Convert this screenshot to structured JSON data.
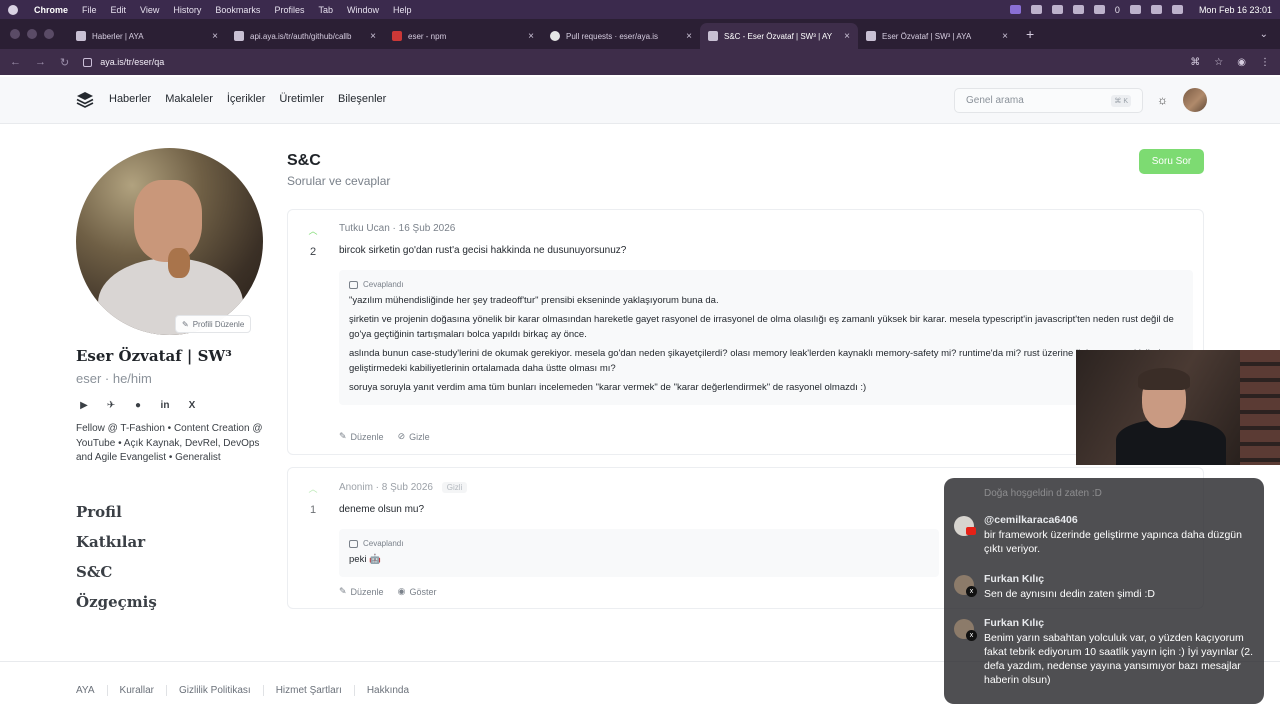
{
  "menubar": {
    "app": "Chrome",
    "items": [
      "File",
      "Edit",
      "View",
      "History",
      "Bookmarks",
      "Profiles",
      "Tab",
      "Window",
      "Help"
    ],
    "status_count": "0",
    "clock": "Mon Feb 16  23:01"
  },
  "tabs": [
    {
      "title": "Haberler | AYA",
      "active": false
    },
    {
      "title": "api.aya.is/tr/auth/github/callb",
      "active": false
    },
    {
      "title": "eser - npm",
      "active": false
    },
    {
      "title": "Pull requests · eser/aya.is",
      "active": false
    },
    {
      "title": "S&C - Eser Özvataf | SW³ | AY",
      "active": true
    },
    {
      "title": "Eser Özvataf | SW³ | AYA",
      "active": false
    }
  ],
  "address": {
    "url": "aya.is/tr/eser/qa"
  },
  "header": {
    "nav": [
      "Haberler",
      "Makaleler",
      "İçerikler",
      "Üretimler",
      "Bileşenler"
    ],
    "search_placeholder": "Genel arama",
    "search_shortcut": "⌘ K"
  },
  "profile": {
    "edit_label": "Profili Düzenle",
    "name": "Eser Özvataf | SW³",
    "handle": "eser · he/him",
    "bio": "Fellow @ T-Fashion • Content Creation @ YouTube • Açık Kaynak, DevRel, DevOps and Agile Evangelist • Generalist",
    "social": [
      "youtube-icon",
      "telegram-icon",
      "github-icon",
      "linkedin-icon",
      "x-icon"
    ],
    "nav": [
      "Profil",
      "Katkılar",
      "S&C",
      "Özgeçmiş"
    ]
  },
  "main": {
    "title": "S&C",
    "subtitle": "Sorular ve cevaplar",
    "ask_button": "Soru Sor",
    "questions": [
      {
        "votes": "2",
        "meta": "Tutku Ucan · 16 Şub 2026",
        "question": "bircok sirketin go'dan rust'a gecisi hakkinda ne dusunuyorsunuz?",
        "answered_label": "Cevaplandı",
        "answer_paragraphs": [
          "\"yazılım mühendisliğinde her şey tradeoff'tur\" prensibi ekseninde yaklaşıyorum buna da.",
          "şirketin ve projenin doğasına yönelik bir karar olmasından hareketle gayet rasyonel de irrasyonel de olma olasılığı eş zamanlı yüksek bir karar. mesela typescript'in javascript'ten neden rust değil de go'ya geçtiğinin tartışmaları bolca yapıldı birkaç ay önce.",
          "aslında bunun case-study'lerini de okumak gerekiyor. mesela go'dan neden şikayetçilerdi? olası memory leak'lerden kaynaklı memory-safety mi? runtime'da mi? rust üzerine ihtisas yapan kişilerin geliştirmedeki kabiliyetlerinin ortalamada daha üstte olması mı?",
          "soruya soruyla yanıt verdim ama tüm bunları incelemeden \"karar vermek\" de \"karar değerlendirmek\" de rasyonel olmazdı :)"
        ],
        "actions": [
          "Düzenle",
          "Gizle"
        ]
      },
      {
        "votes": "1",
        "meta": "Anonim · 8 Şub 2026",
        "badge": "Gizli",
        "question": "deneme olsun mu?",
        "answered_label": "Cevaplandı",
        "answer_paragraphs": [
          "peki 🤖"
        ],
        "actions": [
          "Düzenle",
          "Göster"
        ]
      }
    ]
  },
  "footer": {
    "links": [
      "AYA",
      "Kurallar",
      "Gizlilik Politikası",
      "Hizmet Şartları",
      "Hakkında"
    ]
  },
  "chat": {
    "faded_text": "Doğa hoşgeldin d zaten :D",
    "messages": [
      {
        "author": "@cemilkaraca6406",
        "text": "bir framework üzerinde geliştirme yapınca daha düzgün çıktı veriyor.",
        "platform": "youtube"
      },
      {
        "author": "Furkan Kılıç",
        "text": "Sen de aynısını dedin zaten şimdi :D",
        "platform": "x"
      },
      {
        "author": "Furkan Kılıç",
        "text": "Benim yarın sabahtan yolculuk var, o yüzden kaçıyorum fakat tebrik ediyorum 10 saatlik yayın için :) İyi yayınlar (2. defa yazdım, nedense yayına yansımıyor bazı mesajlar haberin olsun)",
        "platform": "x"
      }
    ]
  },
  "colors": {
    "accent": "#7ddb72",
    "chrome_frame": "#2b1f34",
    "menubar": "#3b2a4d"
  }
}
